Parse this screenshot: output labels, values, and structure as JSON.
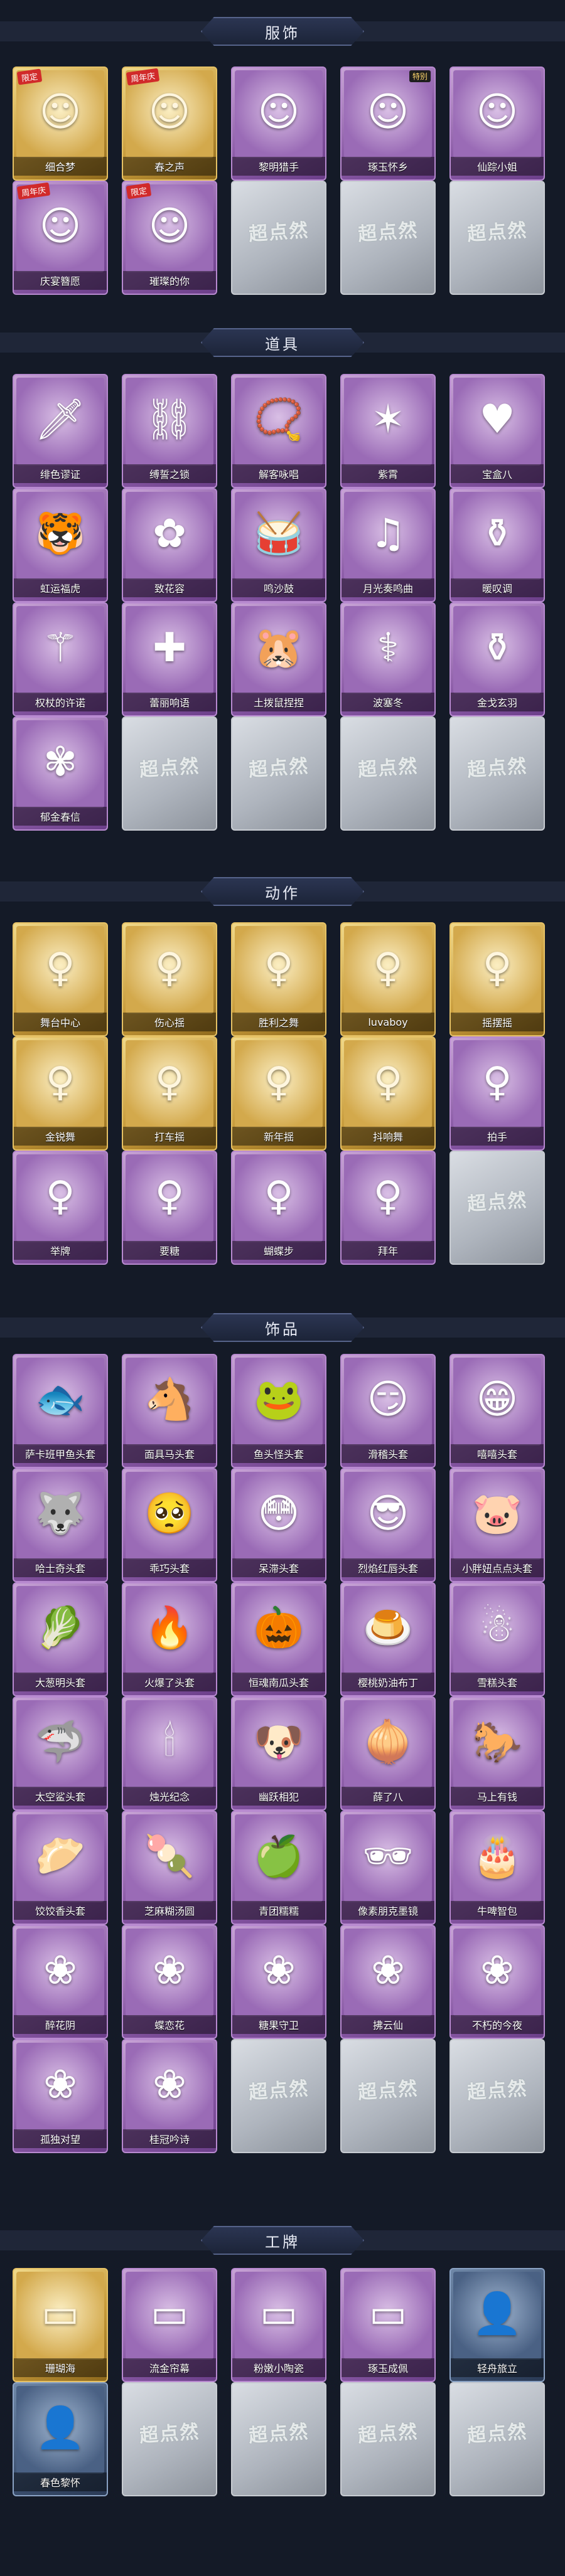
{
  "sections": [
    {
      "title": "服饰",
      "items": [
        {
          "label": "细合梦",
          "tier": "gold",
          "icon": "portrait-icon",
          "glyph": "☺",
          "badge": "限定"
        },
        {
          "label": "春之声",
          "tier": "gold",
          "icon": "portrait-icon",
          "glyph": "☺",
          "badge": "周年庆"
        },
        {
          "label": "黎明猎手",
          "tier": "purple",
          "icon": "portrait-icon",
          "glyph": "☺"
        },
        {
          "label": "琢玉怀乡",
          "tier": "purple",
          "icon": "portrait-icon",
          "glyph": "☺",
          "badge2": "特别"
        },
        {
          "label": "仙踪小姐",
          "tier": "purple",
          "icon": "portrait-icon",
          "glyph": "☺"
        },
        {
          "label": "庆宴簪愿",
          "tier": "purple",
          "icon": "portrait-icon",
          "glyph": "☺",
          "badge": "周年庆"
        },
        {
          "label": "璀璨的你",
          "tier": "purple",
          "icon": "portrait-icon",
          "glyph": "☺",
          "badge": "限定"
        },
        {
          "label": "",
          "tier": "gray",
          "icon": "locked-icon",
          "watermark": "超点然"
        },
        {
          "label": "",
          "tier": "gray",
          "icon": "locked-icon",
          "watermark": "超点然"
        },
        {
          "label": "",
          "tier": "gray",
          "icon": "locked-icon",
          "watermark": "超点然"
        }
      ]
    },
    {
      "title": "道具",
      "items": [
        {
          "label": "绯色谬证",
          "tier": "purple",
          "icon": "sword-icon",
          "glyph": "🗡"
        },
        {
          "label": "缚誓之锁",
          "tier": "purple",
          "icon": "chain-icon",
          "glyph": "⛓"
        },
        {
          "label": "解客咏唱",
          "tier": "purple",
          "icon": "rosary-icon",
          "glyph": "📿"
        },
        {
          "label": "紫霄",
          "tier": "purple",
          "icon": "tassel-icon",
          "glyph": "✶"
        },
        {
          "label": "宝盒八",
          "tier": "purple",
          "icon": "heart-icon",
          "glyph": "♥"
        },
        {
          "label": "虹运福虎",
          "tier": "purple",
          "icon": "tiger-icon",
          "glyph": "🐯"
        },
        {
          "label": "致花容",
          "tier": "purple",
          "icon": "flower-icon",
          "glyph": "✿"
        },
        {
          "label": "鸣沙鼓",
          "tier": "purple",
          "icon": "drum-icon",
          "glyph": "🥁"
        },
        {
          "label": "月光奏鸣曲",
          "tier": "purple",
          "icon": "music-icon",
          "glyph": "♫"
        },
        {
          "label": "暖叹调",
          "tier": "purple",
          "icon": "vase-icon",
          "glyph": "⚱"
        },
        {
          "label": "权杖的许诺",
          "tier": "purple",
          "icon": "scepter-icon",
          "glyph": "⚚"
        },
        {
          "label": "蕾丽响语",
          "tier": "purple",
          "icon": "box-icon",
          "glyph": "✚"
        },
        {
          "label": "土拨鼠捏捏",
          "tier": "purple",
          "icon": "gopher-icon",
          "glyph": "🐹"
        },
        {
          "label": "波塞冬",
          "tier": "purple",
          "icon": "staff-icon",
          "glyph": "⚕"
        },
        {
          "label": "金戈玄羽",
          "tier": "purple",
          "icon": "lantern-icon",
          "glyph": "⚱"
        },
        {
          "label": "郁金春信",
          "tier": "purple",
          "icon": "tulip-icon",
          "glyph": "✾"
        },
        {
          "label": "",
          "tier": "gray",
          "icon": "locked-icon",
          "watermark": "超点然"
        },
        {
          "label": "",
          "tier": "gray",
          "icon": "locked-icon",
          "watermark": "超点然"
        },
        {
          "label": "",
          "tier": "gray",
          "icon": "locked-icon",
          "watermark": "超点然"
        },
        {
          "label": "",
          "tier": "gray",
          "icon": "locked-icon",
          "watermark": "超点然"
        }
      ]
    },
    {
      "title": "动作",
      "items": [
        {
          "label": "舞台中心",
          "tier": "gold",
          "icon": "pose-icon",
          "glyph": "♀"
        },
        {
          "label": "伤心揺",
          "tier": "gold",
          "icon": "pose-icon",
          "glyph": "♀"
        },
        {
          "label": "胜利之舞",
          "tier": "gold",
          "icon": "pose-icon",
          "glyph": "♀"
        },
        {
          "label": "luvaboy",
          "tier": "gold",
          "icon": "pose-icon",
          "glyph": "♀"
        },
        {
          "label": "摇摆摇",
          "tier": "gold",
          "icon": "pose-icon",
          "glyph": "♀"
        },
        {
          "label": "金锐舞",
          "tier": "gold",
          "icon": "pose-icon",
          "glyph": "♀"
        },
        {
          "label": "打车揺",
          "tier": "gold",
          "icon": "pose-icon",
          "glyph": "♀"
        },
        {
          "label": "新年揺",
          "tier": "gold",
          "icon": "pose-icon",
          "glyph": "♀"
        },
        {
          "label": "抖响舞",
          "tier": "gold",
          "icon": "pose-icon",
          "glyph": "♀"
        },
        {
          "label": "拍手",
          "tier": "purple",
          "icon": "pose-icon",
          "glyph": "♀"
        },
        {
          "label": "举牌",
          "tier": "purple",
          "icon": "pose-icon",
          "glyph": "♀"
        },
        {
          "label": "要糖",
          "tier": "purple",
          "icon": "pose-icon",
          "glyph": "♀"
        },
        {
          "label": "蝴蝶步",
          "tier": "purple",
          "icon": "pose-icon",
          "glyph": "♀"
        },
        {
          "label": "拜年",
          "tier": "purple",
          "icon": "pose-icon",
          "glyph": "♀"
        },
        {
          "label": "",
          "tier": "gray",
          "icon": "locked-icon",
          "watermark": "超点然"
        }
      ]
    },
    {
      "title": "饰品",
      "items": [
        {
          "label": "萨卡班甲鱼头套",
          "tier": "purple",
          "icon": "fish-icon",
          "glyph": "🐟"
        },
        {
          "label": "面具马头套",
          "tier": "purple",
          "icon": "horse-icon",
          "glyph": "🐴"
        },
        {
          "label": "鱼头怪头套",
          "tier": "purple",
          "icon": "fish-head-icon",
          "glyph": "🐸"
        },
        {
          "label": "滑稽头套",
          "tier": "purple",
          "icon": "emoji-icon",
          "glyph": "😏"
        },
        {
          "label": "嘻嘻头套",
          "tier": "purple",
          "icon": "emoji-icon",
          "glyph": "😁"
        },
        {
          "label": "哈士奇头套",
          "tier": "purple",
          "icon": "dog-icon",
          "glyph": "🐺"
        },
        {
          "label": "乖巧头套",
          "tier": "purple",
          "icon": "emoji-icon",
          "glyph": "🥺"
        },
        {
          "label": "呆滞头套",
          "tier": "purple",
          "icon": "emoji-icon",
          "glyph": "😳"
        },
        {
          "label": "烈焰红唇头套",
          "tier": "purple",
          "icon": "pikachu-icon",
          "glyph": "😎"
        },
        {
          "label": "小胖妞点点头套",
          "tier": "purple",
          "icon": "chubby-icon",
          "glyph": "🐷"
        },
        {
          "label": "大葱明头套",
          "tier": "purple",
          "icon": "cabbage-icon",
          "glyph": "🥬"
        },
        {
          "label": "火爆了头套",
          "tier": "purple",
          "icon": "fire-icon",
          "glyph": "🔥"
        },
        {
          "label": "恒魂南瓜头套",
          "tier": "purple",
          "icon": "pumpkin-icon",
          "glyph": "🎃"
        },
        {
          "label": "樱桃奶油布丁",
          "tier": "purple",
          "icon": "pudding-icon",
          "glyph": "🍮"
        },
        {
          "label": "雪糕头套",
          "tier": "purple",
          "icon": "snowman-icon",
          "glyph": "☃"
        },
        {
          "label": "太空鲨头套",
          "tier": "purple",
          "icon": "shark-icon",
          "glyph": "🦈"
        },
        {
          "label": "烛光纪念",
          "tier": "purple",
          "icon": "candle-icon",
          "glyph": "🕯"
        },
        {
          "label": "幽跃相犯",
          "tier": "purple",
          "icon": "sausage-dog-icon",
          "glyph": "🐶"
        },
        {
          "label": "薛了八",
          "tier": "purple",
          "icon": "onion-icon",
          "glyph": "🧅"
        },
        {
          "label": "马上有钱",
          "tier": "purple",
          "icon": "horse-icon",
          "glyph": "🐎"
        },
        {
          "label": "饺饺香头套",
          "tier": "purple",
          "icon": "dumpling-icon",
          "glyph": "🥟"
        },
        {
          "label": "芝麻糊汤圆",
          "tier": "purple",
          "icon": "tangyuan-icon",
          "glyph": "🍡"
        },
        {
          "label": "青团糯糯",
          "tier": "purple",
          "icon": "qingtuan-icon",
          "glyph": "🍏"
        },
        {
          "label": "像素朋克墨镜",
          "tier": "purple",
          "icon": "sunglasses-icon",
          "glyph": "🕶"
        },
        {
          "label": "牛啤智包",
          "tier": "purple",
          "icon": "cake-icon",
          "glyph": "🎂"
        },
        {
          "label": "醉花阴",
          "tier": "purple",
          "icon": "ornament-icon",
          "glyph": "❀"
        },
        {
          "label": "蝶恋花",
          "tier": "purple",
          "icon": "ornament-icon",
          "glyph": "❀"
        },
        {
          "label": "糖果守卫",
          "tier": "purple",
          "icon": "ornament-icon",
          "glyph": "❀"
        },
        {
          "label": "拂云仙",
          "tier": "purple",
          "icon": "ornament-icon",
          "glyph": "❀"
        },
        {
          "label": "不朽的今夜",
          "tier": "purple",
          "icon": "ornament-icon",
          "glyph": "❀"
        },
        {
          "label": "孤独对望",
          "tier": "purple",
          "icon": "ornament-icon",
          "glyph": "❀"
        },
        {
          "label": "桂冠吟诗",
          "tier": "purple",
          "icon": "ornament-icon",
          "glyph": "❀"
        },
        {
          "label": "",
          "tier": "gray",
          "icon": "locked-icon",
          "watermark": "超点然"
        },
        {
          "label": "",
          "tier": "gray",
          "icon": "locked-icon",
          "watermark": "超点然"
        },
        {
          "label": "",
          "tier": "gray",
          "icon": "locked-icon",
          "watermark": "超点然"
        }
      ]
    },
    {
      "title": "工牌",
      "items": [
        {
          "label": "珊瑚海",
          "tier": "gold",
          "icon": "card-icon",
          "glyph": "▭"
        },
        {
          "label": "流金帘幕",
          "tier": "purple",
          "icon": "card-icon",
          "glyph": "▭"
        },
        {
          "label": "粉嫩小陶瓷",
          "tier": "purple",
          "icon": "card-icon",
          "glyph": "▭"
        },
        {
          "label": "琢玉成佩",
          "tier": "purple",
          "icon": "card-icon",
          "glyph": "▭"
        },
        {
          "label": "轻舟旅立",
          "tier": "blue",
          "icon": "silhouette-card-icon",
          "glyph": "👤"
        },
        {
          "label": "春色黎怀",
          "tier": "blue",
          "icon": "silhouette-card-icon",
          "glyph": "👤"
        },
        {
          "label": "",
          "tier": "gray",
          "icon": "locked-icon",
          "watermark": "超点然"
        },
        {
          "label": "",
          "tier": "gray",
          "icon": "locked-icon",
          "watermark": "超点然"
        },
        {
          "label": "",
          "tier": "gray",
          "icon": "locked-icon",
          "watermark": "超点然"
        },
        {
          "label": "",
          "tier": "gray",
          "icon": "locked-icon",
          "watermark": "超点然"
        }
      ]
    }
  ]
}
